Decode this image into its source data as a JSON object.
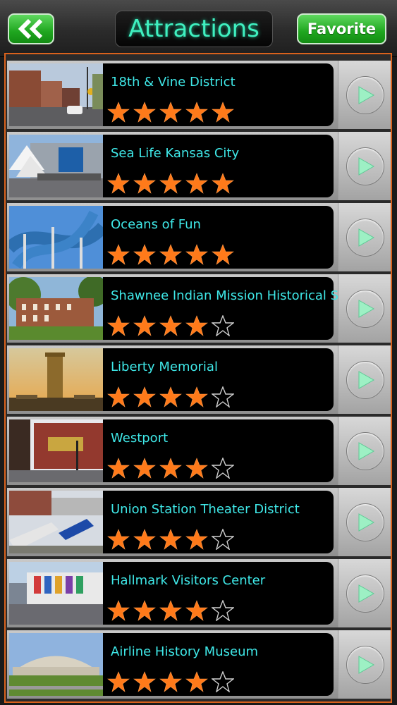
{
  "header": {
    "title": "Attractions",
    "favorite_label": "Favorite",
    "back_icon": "double-chevron-left-icon"
  },
  "colors": {
    "accent_green": "#22aa22",
    "title_text": "#3ff0c0",
    "item_text": "#3fe8e8",
    "star_fill": "#ff7a1a",
    "list_border": "#d9611c"
  },
  "attractions": [
    {
      "name": "18th & Vine District",
      "rating": 5,
      "thumb": "street"
    },
    {
      "name": "Sea Life Kansas City",
      "rating": 5,
      "thumb": "aquarium"
    },
    {
      "name": "Oceans of Fun",
      "rating": 5,
      "thumb": "waterslide"
    },
    {
      "name": "Shawnee Indian Mission Historical Site",
      "rating": 4,
      "thumb": "brick-building"
    },
    {
      "name": "Liberty Memorial",
      "rating": 4,
      "thumb": "tower"
    },
    {
      "name": "Westport",
      "rating": 4,
      "thumb": "brick-corner"
    },
    {
      "name": "Union Station Theater District",
      "rating": 4,
      "thumb": "trains"
    },
    {
      "name": "Hallmark Visitors Center",
      "rating": 4,
      "thumb": "banners-building"
    },
    {
      "name": "Airline History Museum",
      "rating": 4,
      "thumb": "hangar"
    }
  ]
}
